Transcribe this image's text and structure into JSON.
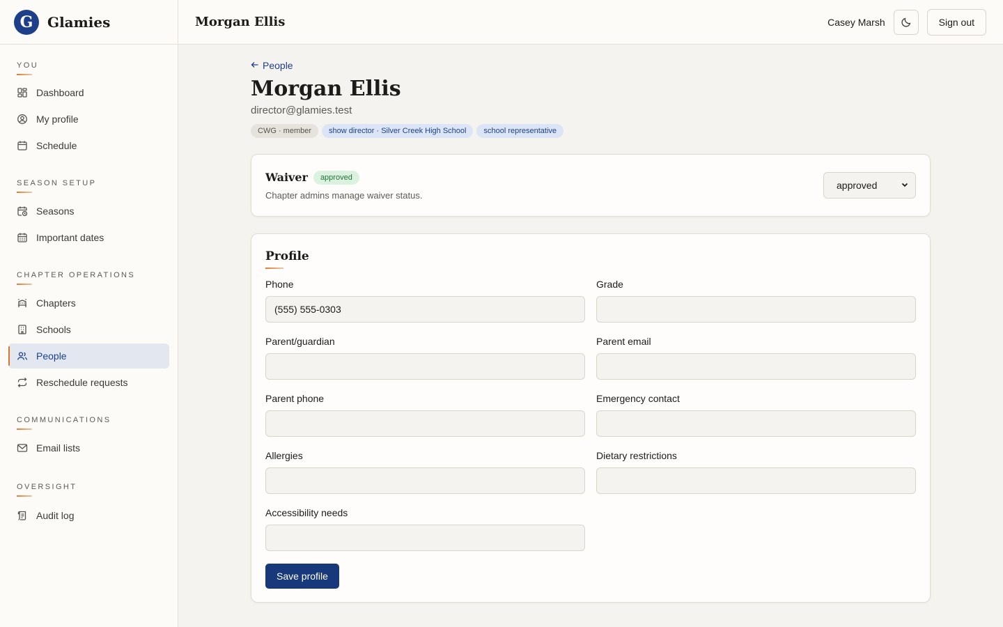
{
  "brand": {
    "name": "Glamies",
    "logo_letter": "G"
  },
  "colors": {
    "accent": "#1d3f8a",
    "orange": "#e07a2f",
    "success": "#24703a"
  },
  "sidebar": {
    "sections": [
      {
        "title": "YOU",
        "items": [
          {
            "label": "Dashboard",
            "icon": "dashboard-icon"
          },
          {
            "label": "My profile",
            "icon": "user-circle-icon"
          },
          {
            "label": "Schedule",
            "icon": "calendar-icon"
          }
        ]
      },
      {
        "title": "SEASON SETUP",
        "items": [
          {
            "label": "Seasons",
            "icon": "calendar-clock-icon"
          },
          {
            "label": "Important dates",
            "icon": "calendar-grid-icon"
          }
        ]
      },
      {
        "title": "CHAPTER OPERATIONS",
        "items": [
          {
            "label": "Chapters",
            "icon": "chapters-icon"
          },
          {
            "label": "Schools",
            "icon": "building-icon"
          },
          {
            "label": "People",
            "icon": "people-icon",
            "active": true
          },
          {
            "label": "Reschedule requests",
            "icon": "repeat-icon"
          }
        ]
      },
      {
        "title": "COMMUNICATIONS",
        "items": [
          {
            "label": "Email lists",
            "icon": "mail-icon"
          }
        ]
      },
      {
        "title": "OVERSIGHT",
        "items": [
          {
            "label": "Audit log",
            "icon": "scroll-icon"
          }
        ]
      }
    ]
  },
  "topbar": {
    "title": "Morgan Ellis",
    "user": "Casey Marsh",
    "theme_icon": "moon-icon",
    "signout_label": "Sign out"
  },
  "main": {
    "back_label": "People",
    "name": "Morgan Ellis",
    "email": "director@glamies.test",
    "badges": [
      {
        "label": "CWG · member",
        "tone": "gray"
      },
      {
        "label": "show director · Silver Creek High School",
        "tone": "blue"
      },
      {
        "label": "school representative",
        "tone": "blue"
      }
    ]
  },
  "waiver": {
    "title": "Waiver",
    "status": "approved",
    "subtitle": "Chapter admins manage waiver status.",
    "selected": "approved"
  },
  "profile": {
    "title": "Profile",
    "fields": [
      {
        "label": "Phone",
        "value": "(555) 555-0303"
      },
      {
        "label": "Grade",
        "value": ""
      },
      {
        "label": "Parent/guardian",
        "value": ""
      },
      {
        "label": "Parent email",
        "value": ""
      },
      {
        "label": "Parent phone",
        "value": ""
      },
      {
        "label": "Emergency contact",
        "value": ""
      },
      {
        "label": "Allergies",
        "value": ""
      },
      {
        "label": "Dietary restrictions",
        "value": ""
      },
      {
        "label": "Accessibility needs",
        "value": ""
      }
    ],
    "save_label": "Save profile"
  }
}
